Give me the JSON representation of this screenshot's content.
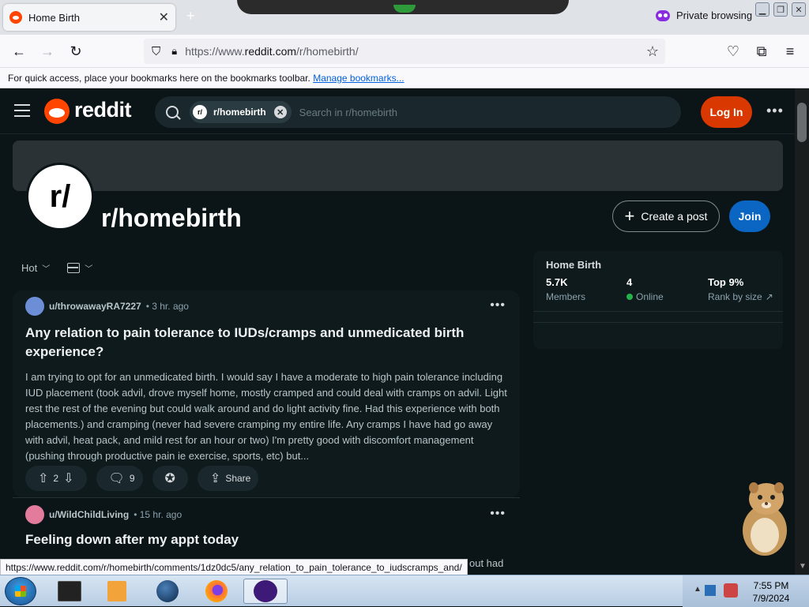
{
  "browser": {
    "tab_title": "Home Birth",
    "tab_close": "✕",
    "new_tab": "+",
    "private_label": "Private browsing",
    "url_prefix": "https://www.",
    "url_host": "reddit.com",
    "url_path": "/r/homebirth/",
    "bookmarks_text": "For quick access, place your bookmarks here on the bookmarks toolbar.",
    "bookmarks_link": "Manage bookmarks..."
  },
  "reddit": {
    "wordmark": "reddit",
    "search_chip": "r/homebirth",
    "search_chip_icon": "r/",
    "search_placeholder": "Search in r/homebirth",
    "login_label": "Log In",
    "more_label": "•••"
  },
  "subreddit": {
    "icon_text": "r/",
    "name": "r/homebirth",
    "create_post_label": "Create a post",
    "join_label": "Join",
    "sort_label": "Hot"
  },
  "sidebar": {
    "title": "Home Birth",
    "members_value": "5.7K",
    "members_label": "Members",
    "online_value": "4",
    "online_label": "Online",
    "rank_value": "Top 9%",
    "rank_label": "Rank by size"
  },
  "posts": [
    {
      "user": "u/throwawayRA7227",
      "time": "• 3 hr. ago",
      "title": "Any relation to pain tolerance to IUDs/cramps and unmedicated birth experience?",
      "body": "I am trying to opt for an unmedicated birth. I would say I have a moderate to high pain tolerance including IUD placement (took advil, drove myself home, mostly cramped and could deal with cramps on advil. Light rest the rest of the evening but could walk around and do light activity fine. Had this experience with both placements.) and cramping (never had severe cramping my entire life. Any cramps I have had go away with advil, heat pack, and mild rest for an hour or two) I'm pretty good with discomfort management (pushing through productive pain ie exercise, sports, etc) but...",
      "votes": "2",
      "comments": "9",
      "share_label": "Share"
    },
    {
      "user": "u/WildChildLiving",
      "time": "• 15 hr. ago",
      "title": "Feeling down after my appt today",
      "body_fragment": "out had"
    }
  ],
  "status_url": "https://www.reddit.com/r/homebirth/comments/1dz0dc5/any_relation_to_pain_tolerance_to_iudscramps_and/",
  "taskbar": {
    "time": "7:55 PM",
    "date": "7/9/2024"
  },
  "colors": {
    "reddit_orange": "#ff4500",
    "login_button": "#d93900",
    "join_button": "#0a66c2",
    "online_dot": "#25b24a",
    "page_bg": "#0b1416"
  }
}
